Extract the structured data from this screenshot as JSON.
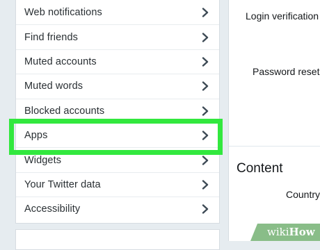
{
  "menu": {
    "items": [
      {
        "label": "Web notifications",
        "icon": "chevron-right-icon"
      },
      {
        "label": "Find friends",
        "icon": "chevron-right-icon"
      },
      {
        "label": "Muted accounts",
        "icon": "chevron-right-icon"
      },
      {
        "label": "Muted words",
        "icon": "chevron-right-icon"
      },
      {
        "label": "Blocked accounts",
        "icon": "chevron-right-icon"
      },
      {
        "label": "Apps",
        "icon": "chevron-right-icon",
        "highlighted": true
      },
      {
        "label": "Widgets",
        "icon": "chevron-right-icon"
      },
      {
        "label": "Your Twitter data",
        "icon": "chevron-right-icon"
      },
      {
        "label": "Accessibility",
        "icon": "chevron-right-icon"
      }
    ]
  },
  "main": {
    "login_verification": "Login verification",
    "password_reset": "Password reset",
    "content_title": "Content",
    "country": "Country"
  },
  "watermark": {
    "part1": "wiki",
    "part2": "How"
  },
  "colors": {
    "highlight_border": "#32e83e",
    "page_bg": "#e6ecf0",
    "chevron": "#657786"
  }
}
